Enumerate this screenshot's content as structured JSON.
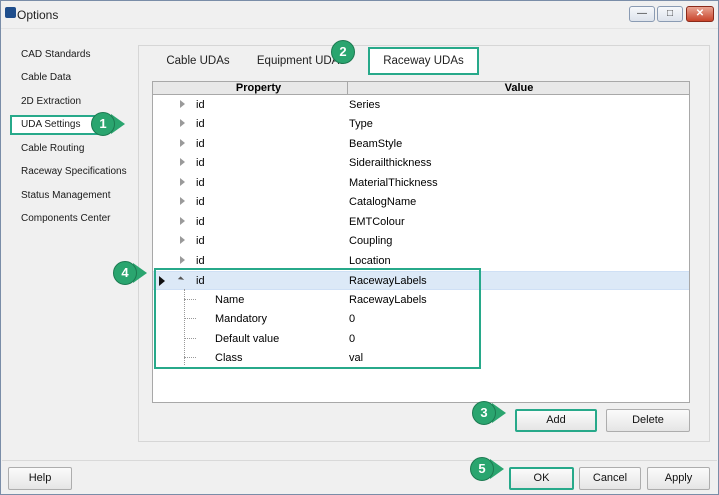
{
  "window": {
    "title": "Options"
  },
  "nav": {
    "items": [
      "CAD Standards",
      "Cable Data",
      "2D Extraction",
      "UDA Settings",
      "Cable Routing",
      "Raceway Specifications",
      "Status Management",
      "Components Center"
    ],
    "selected_index": 3
  },
  "tabs": [
    "Cable UDAs",
    "Equipment UDAs",
    "Raceway UDAs"
  ],
  "active_tab": 2,
  "grid": {
    "columns": [
      "Property",
      "Value"
    ],
    "rows": [
      {
        "property": "id",
        "value": "Series"
      },
      {
        "property": "id",
        "value": "Type"
      },
      {
        "property": "id",
        "value": "BeamStyle"
      },
      {
        "property": "id",
        "value": "Siderailthickness"
      },
      {
        "property": "id",
        "value": "MaterialThickness"
      },
      {
        "property": "id",
        "value": "CatalogName"
      },
      {
        "property": "id",
        "value": "EMTColour"
      },
      {
        "property": "id",
        "value": "Coupling"
      },
      {
        "property": "id",
        "value": "Location"
      },
      {
        "property": "id",
        "value": "RacewayLabels"
      }
    ],
    "children": [
      {
        "property": "Name",
        "value": "RacewayLabels"
      },
      {
        "property": "Mandatory",
        "value": "0"
      },
      {
        "property": "Default value",
        "value": "0"
      },
      {
        "property": "Class",
        "value": "val"
      }
    ]
  },
  "buttons": {
    "add": "Add",
    "delete": "Delete",
    "help": "Help",
    "ok": "OK",
    "cancel": "Cancel",
    "apply": "Apply"
  },
  "callouts": [
    "1",
    "2",
    "3",
    "4",
    "5"
  ],
  "colors": {
    "highlight": "#27a98a",
    "callout": "#2aa56f",
    "selection": "#dce9f7"
  }
}
